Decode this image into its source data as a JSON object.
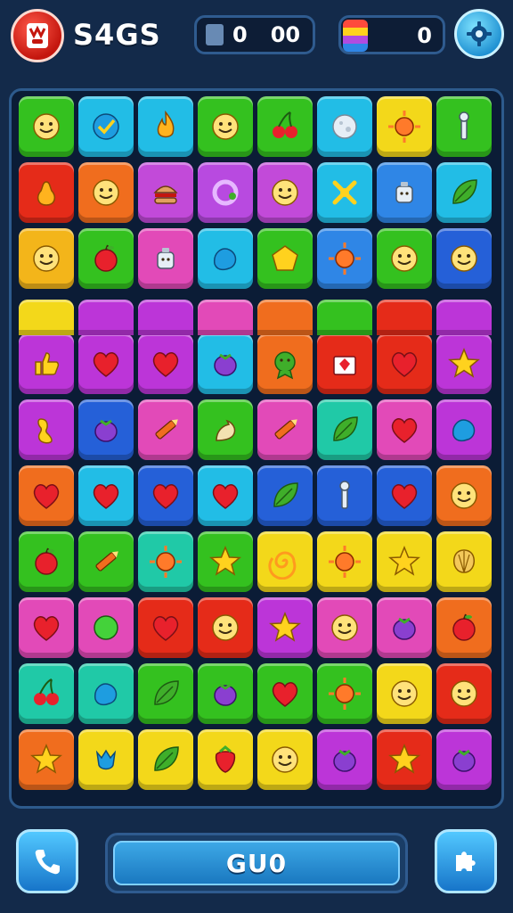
{
  "header": {
    "title": "S4GS",
    "counter_primary": "0",
    "counter_secondary": "00",
    "lives_value": "0",
    "logo_icon": "mascot-logo-icon",
    "settings_icon": "gear-icon"
  },
  "board": {
    "rows": [
      [
        [
          "#34c11f",
          "smiley-icon"
        ],
        [
          "#22bde6",
          "checkmark-icon"
        ],
        [
          "#22bde6",
          "flame-icon"
        ],
        [
          "#34c11f",
          "smiley-icon"
        ],
        [
          "#34c11f",
          "cherry-icon"
        ],
        [
          "#22bde6",
          "moon-icon"
        ],
        [
          "#f3d81a",
          "sun-icon"
        ],
        [
          "#34c11f",
          "wrench-icon"
        ]
      ],
      [
        [
          "#e52b19",
          "pear-icon"
        ],
        [
          "#f06d1e",
          "baby-face-icon"
        ],
        [
          "#c24ad9",
          "burger-icon"
        ],
        [
          "#b84ae0",
          "ring-icon"
        ],
        [
          "#c24ad9",
          "face-icon"
        ],
        [
          "#22bde6",
          "crossbones-icon"
        ],
        [
          "#2f86e6",
          "teapot-icon"
        ],
        [
          "#22bde6",
          "leaf-icon"
        ]
      ],
      [
        [
          "#f3b51a",
          "cat-face-icon"
        ],
        [
          "#34c11f",
          "apple-icon"
        ],
        [
          "#e24ab8",
          "jar-icon"
        ],
        [
          "#22bde6",
          "blob-icon"
        ],
        [
          "#34c11f",
          "pentagon-icon"
        ],
        [
          "#2f86e6",
          "sun-icon"
        ],
        [
          "#34c11f",
          "smiley-icon"
        ],
        [
          "#2560d8",
          "sun-face-icon"
        ]
      ],
      [
        [
          "#bc35d8",
          "thumbs-up-icon"
        ],
        [
          "#bc35d8",
          "heart-icon"
        ],
        [
          "#bc35d8",
          "heart-icon"
        ],
        [
          "#22bde6",
          "eggplant-icon"
        ],
        [
          "#f06d1e",
          "star-badge-icon"
        ],
        [
          "#e52b19",
          "gift-icon"
        ],
        [
          "#e52b19",
          "heart-icon"
        ],
        [
          "#bc35d8",
          "star-icon"
        ]
      ],
      [
        [
          "#bc35d8",
          "peanut-icon"
        ],
        [
          "#2560d8",
          "eggplant-icon"
        ],
        [
          "#e24ab8",
          "crayon-icon"
        ],
        [
          "#34c11f",
          "sprout-icon"
        ],
        [
          "#e24ab8",
          "crayon-icon"
        ],
        [
          "#20c9a7",
          "leaf-icon"
        ],
        [
          "#e24ab8",
          "heart-icon"
        ],
        [
          "#bc35d8",
          "blob-icon"
        ]
      ],
      [
        [
          "#f06d1e",
          "heart-icon"
        ],
        [
          "#22bde6",
          "heart-icon"
        ],
        [
          "#2560d8",
          "heart-icon"
        ],
        [
          "#22bde6",
          "heart-icon"
        ],
        [
          "#2560d8",
          "leaf-icon"
        ],
        [
          "#2560d8",
          "plug-icon"
        ],
        [
          "#2560d8",
          "heart-icon"
        ],
        [
          "#f06d1e",
          "smiley-icon"
        ]
      ],
      [
        [
          "#34c11f",
          "tomato-icon"
        ],
        [
          "#34c11f",
          "crayon-icon"
        ],
        [
          "#20c9a7",
          "sun-icon"
        ],
        [
          "#34c11f",
          "star-icon"
        ],
        [
          "#f3d81a",
          "swirl-icon"
        ],
        [
          "#f3d81a",
          "sun-icon"
        ],
        [
          "#f3d81a",
          "star-icon"
        ],
        [
          "#f3d81a",
          "shell-icon"
        ]
      ],
      [
        [
          "#e24ab8",
          "heart-icon"
        ],
        [
          "#e24ab8",
          "circle-icon"
        ],
        [
          "#e52b19",
          "heart-icon"
        ],
        [
          "#e52b19",
          "cat-face-icon"
        ],
        [
          "#bc35d8",
          "star-icon"
        ],
        [
          "#e24ab8",
          "smiley-icon"
        ],
        [
          "#e24ab8",
          "eggplant-icon"
        ],
        [
          "#f06d1e",
          "apple-icon"
        ]
      ],
      [
        [
          "#20c9a7",
          "cherry-icon"
        ],
        [
          "#20c9a7",
          "blob-icon"
        ],
        [
          "#34c11f",
          "leaf-icon"
        ],
        [
          "#34c11f",
          "eggplant-icon"
        ],
        [
          "#34c11f",
          "heart-icon"
        ],
        [
          "#34c11f",
          "sun-icon"
        ],
        [
          "#f3d81a",
          "baby-face-icon"
        ],
        [
          "#e52b19",
          "baby-face-icon"
        ]
      ],
      [
        [
          "#f06d1e",
          "star-icon"
        ],
        [
          "#f3d81a",
          "tulip-icon"
        ],
        [
          "#f3d81a",
          "leaf-icon"
        ],
        [
          "#f3d81a",
          "strawberry-icon"
        ],
        [
          "#f3d81a",
          "cat-face-icon"
        ],
        [
          "#bc35d8",
          "beet-icon"
        ],
        [
          "#e52b19",
          "star-icon"
        ],
        [
          "#bc35d8",
          "beet-icon"
        ]
      ]
    ],
    "strip_colors": [
      "#f3d81a",
      "#bc35d8",
      "#bc35d8",
      "#e24ab8",
      "#f06d1e",
      "#34c11f",
      "#e52b19",
      "#bc35d8"
    ]
  },
  "footer": {
    "go_label": "GU0",
    "left_icon": "phone-icon",
    "right_icon": "puzzle-icon"
  }
}
